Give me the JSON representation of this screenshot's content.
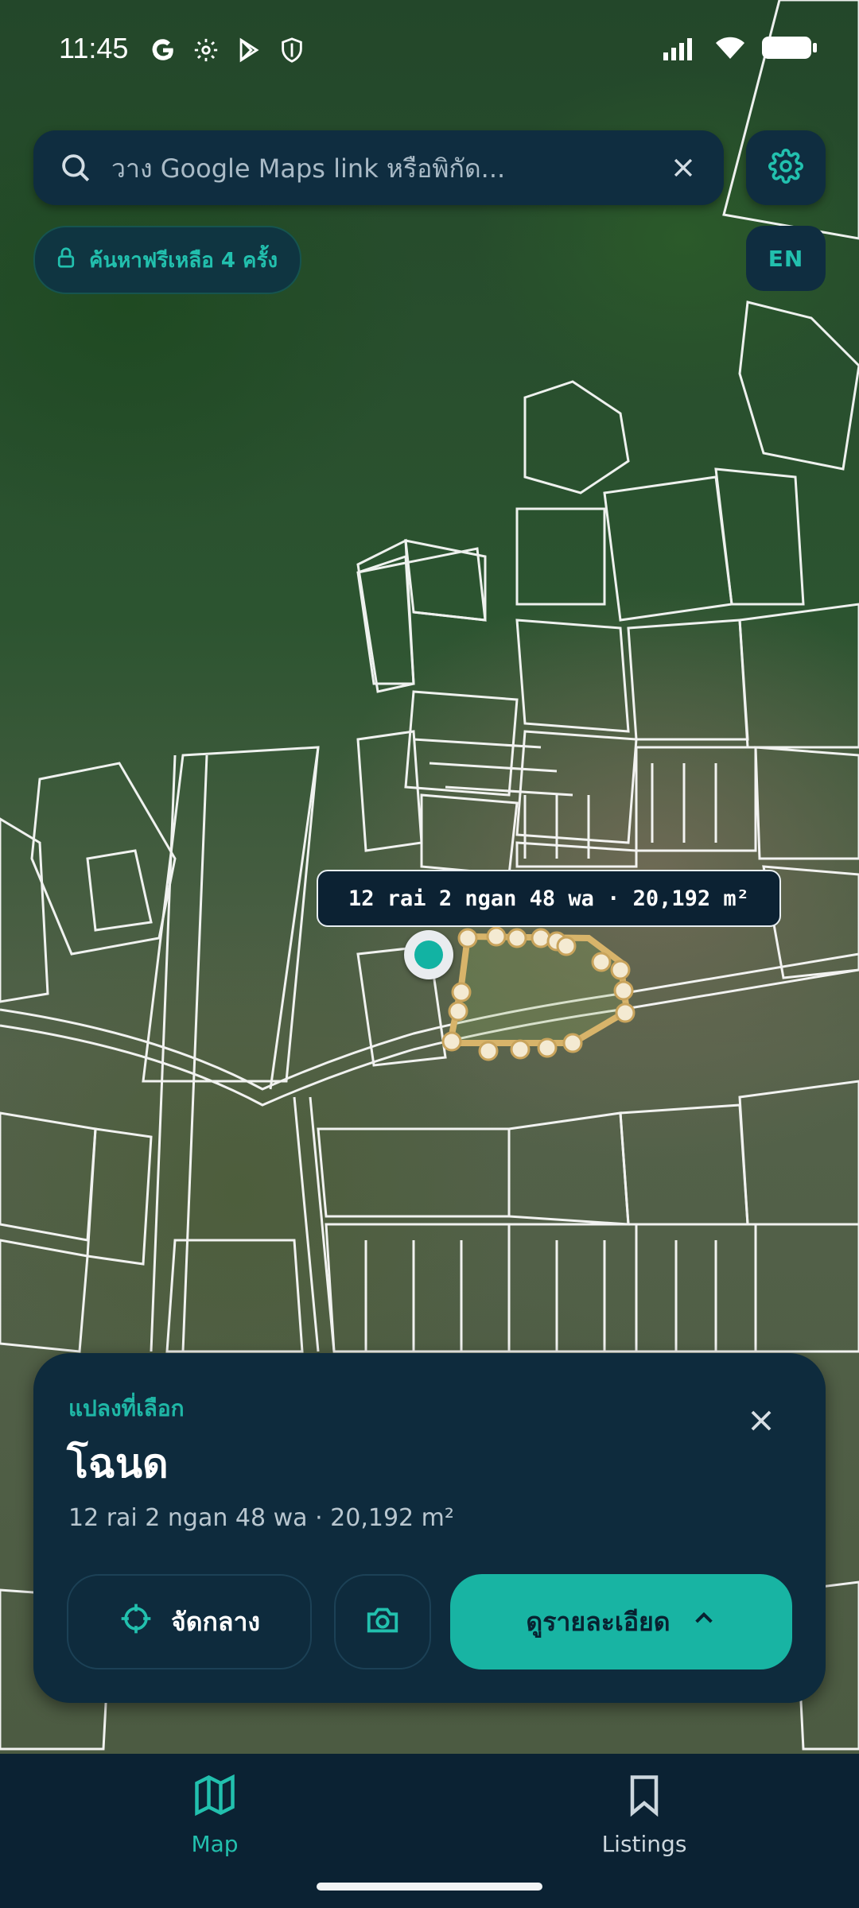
{
  "status_bar": {
    "time": "11:45",
    "left_icons": [
      "google-icon",
      "settings-icon",
      "play-store-icon",
      "shield-icon"
    ],
    "right_icons": [
      "signal-icon",
      "wifi-icon",
      "battery-icon"
    ]
  },
  "search": {
    "placeholder": "วาง Google Maps link หรือพิกัด...",
    "value": ""
  },
  "free_search_badge": {
    "label": "ค้นหาฟรีเหลือ 4 ครั้ง"
  },
  "language_button": {
    "label": "EN"
  },
  "map": {
    "area_tooltip": "12 rai 2 ngan 48 wa · 20,192 m²"
  },
  "parcel_card": {
    "section_label": "แปลงที่เลือก",
    "title": "โฉนด",
    "subtitle": "12 rai 2 ngan 48 wa · 20,192 m²",
    "center_button": "จัดกลาง",
    "details_button": "ดูรายละเอียด"
  },
  "bottom_nav": {
    "items": [
      {
        "label": "Map",
        "icon": "map-icon",
        "active": true
      },
      {
        "label": "Listings",
        "icon": "bookmark-icon",
        "active": false
      }
    ]
  },
  "colors": {
    "accent": "#18b4a3",
    "panel": "#0e2b3d",
    "nav_background": "#0b2233",
    "parcel_outline": "#d8b46a"
  }
}
